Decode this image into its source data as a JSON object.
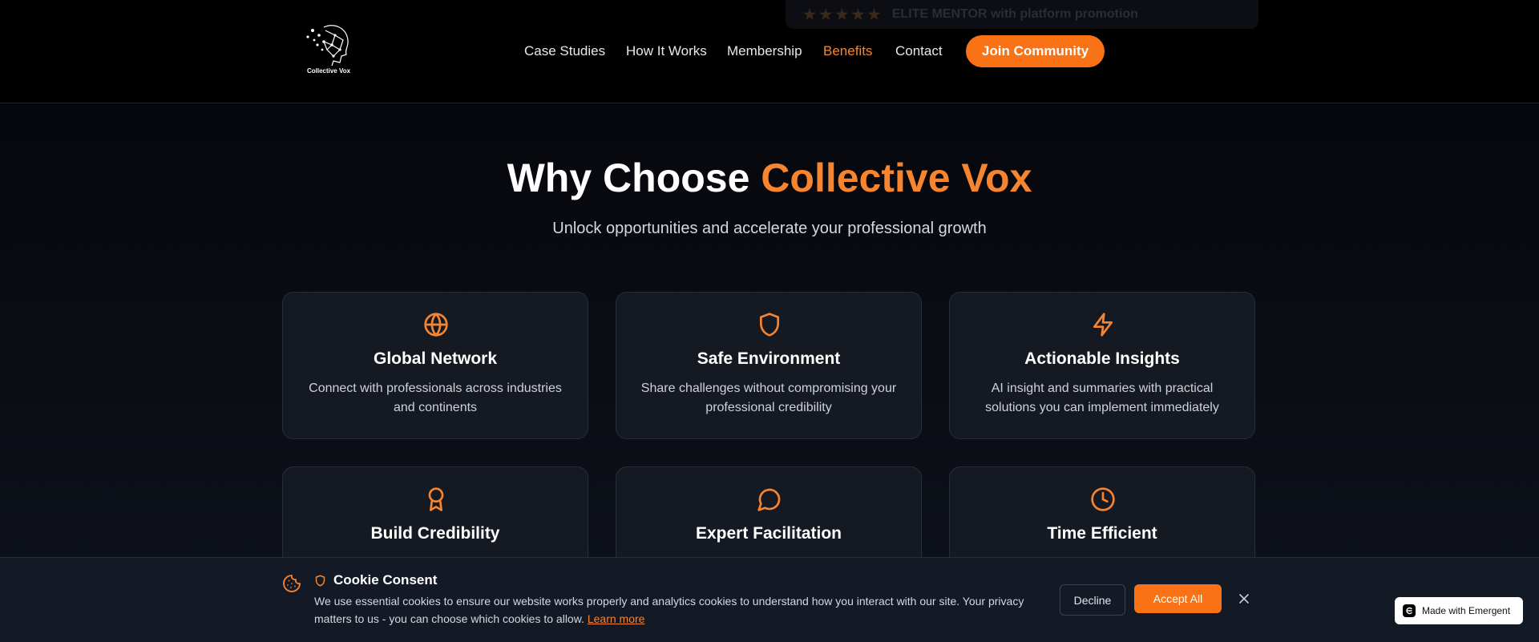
{
  "header": {
    "ghost_strip_text": "ELITE MENTOR with platform promotion",
    "logo_text": "Collective Vox",
    "nav": [
      {
        "label": "Case Studies",
        "active": false
      },
      {
        "label": "How It Works",
        "active": false
      },
      {
        "label": "Membership",
        "active": false
      },
      {
        "label": "Benefits",
        "active": true
      },
      {
        "label": "Contact",
        "active": false
      }
    ],
    "cta_label": "Join Community"
  },
  "hero": {
    "title_prefix": "Why Choose ",
    "title_accent": "Collective Vox",
    "subtitle": "Unlock opportunities and accelerate your professional growth"
  },
  "benefits": [
    {
      "icon": "globe-icon",
      "title": "Global Network",
      "description": "Connect with professionals across industries and continents"
    },
    {
      "icon": "shield-icon",
      "title": "Safe Environment",
      "description": "Share challenges without compromising your professional credibility"
    },
    {
      "icon": "lightning-icon",
      "title": "Actionable Insights",
      "description": "AI insight and summaries with practical solutions you can implement immediately"
    },
    {
      "icon": "award-icon",
      "title": "Build Credibility",
      "description": ""
    },
    {
      "icon": "message-circle-icon",
      "title": "Expert Facilitation",
      "description": ""
    },
    {
      "icon": "clock-icon",
      "title": "Time Efficient",
      "description": ""
    }
  ],
  "cookie": {
    "title": "Cookie Consent",
    "text": "We use essential cookies to ensure our website works properly and analytics cookies to understand how you interact with our site. Your privacy matters to us - you can choose which cookies to allow.",
    "link": "Learn more",
    "decline": "Decline",
    "accept": "Accept All"
  },
  "badge": {
    "text": "Made with Emergent"
  },
  "colors": {
    "accent": "#f97316",
    "background": "#05060a",
    "card": "#151922"
  }
}
